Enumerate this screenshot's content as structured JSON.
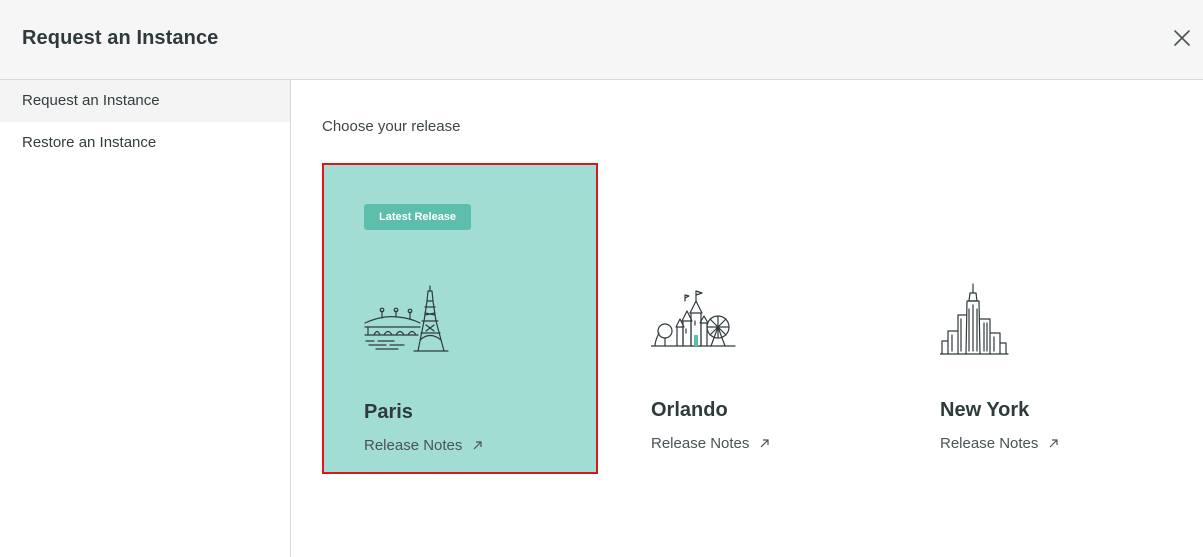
{
  "header": {
    "title": "Request an Instance",
    "close_icon": "close-icon"
  },
  "sidebar": {
    "items": [
      {
        "label": "Request an Instance",
        "active": true
      },
      {
        "label": "Restore an Instance",
        "active": false
      }
    ]
  },
  "main": {
    "section_label": "Choose your release",
    "releases": [
      {
        "name": "Paris",
        "badge": "Latest Release",
        "notes_label": "Release Notes",
        "selected": true,
        "icon": "eiffel-tower-icon"
      },
      {
        "name": "Orlando",
        "notes_label": "Release Notes",
        "selected": false,
        "icon": "orlando-castle-icon"
      },
      {
        "name": "New York",
        "notes_label": "Release Notes",
        "selected": false,
        "icon": "new-york-skyline-icon"
      }
    ]
  },
  "colors": {
    "selected_card_bg": "#a2ddd3",
    "selected_border": "#d9181c",
    "badge_bg": "#5dbfab",
    "text_dark": "#2f3a3d"
  }
}
